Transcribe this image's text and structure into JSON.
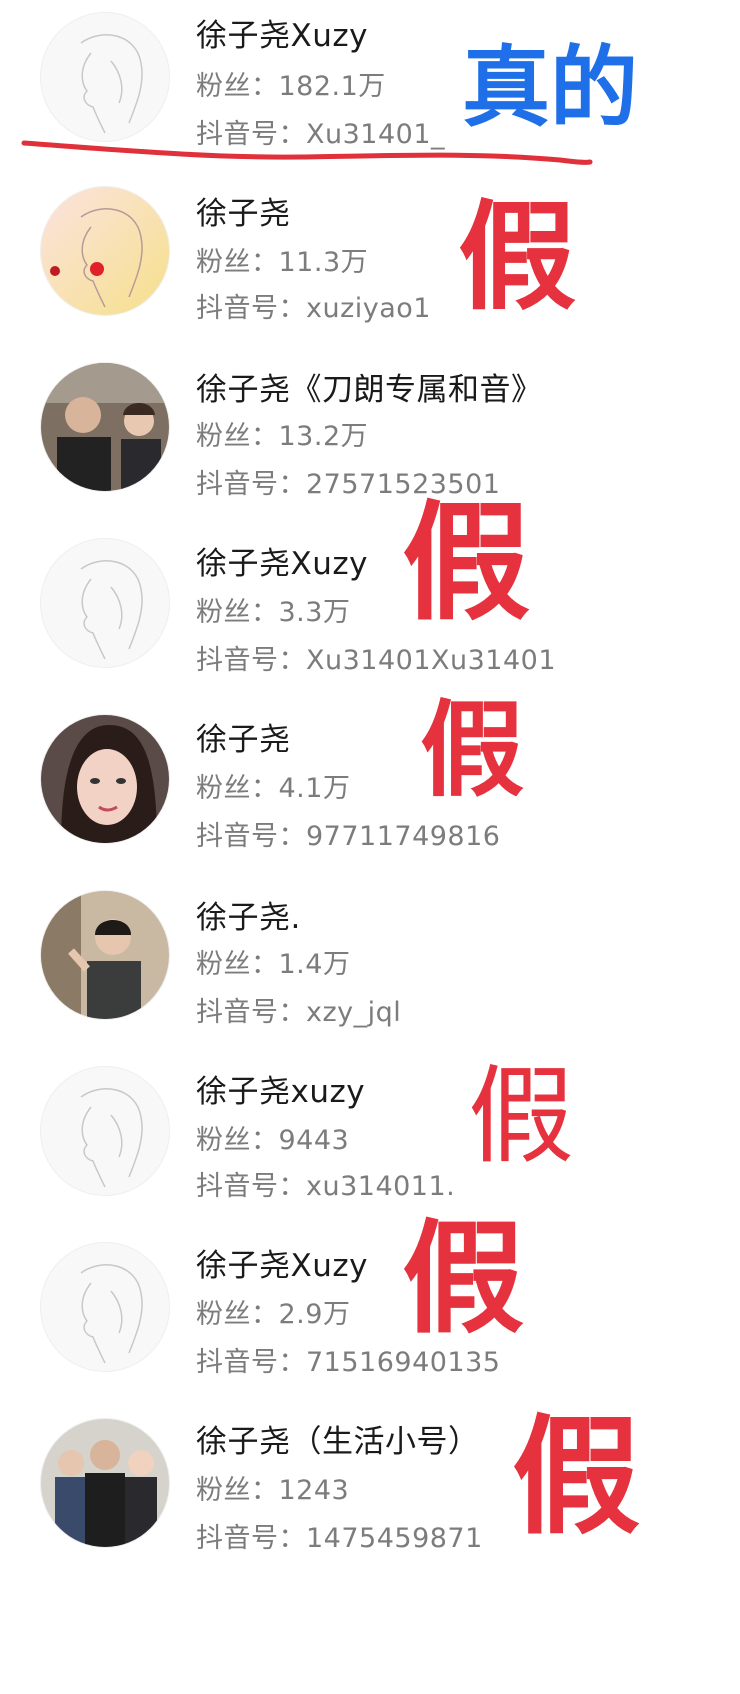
{
  "colors": {
    "fake_stamp": "#e5323e",
    "real_stamp": "#1f6fe8",
    "underline": "#e0303a",
    "name_text": "#1a1a1a",
    "meta_text": "#7c7c7c"
  },
  "accounts": [
    {
      "name": "徐子尧Xuzy",
      "fans": "粉丝：182.1万",
      "douyin_id": "抖音号：Xu31401_",
      "avatar": "line-art-portrait",
      "stamp": "真的"
    },
    {
      "name": "徐子尧",
      "fans": "粉丝：11.3万",
      "douyin_id": "抖音号：xuziyao1",
      "avatar": "line-art-portrait-red",
      "stamp": "假"
    },
    {
      "name": "徐子尧《刀朗专属和音》",
      "fans": "粉丝：13.2万",
      "douyin_id": "抖音号：27571523501",
      "avatar": "photo-two-people",
      "stamp": ""
    },
    {
      "name": "徐子尧Xuzy",
      "fans": "粉丝：3.3万",
      "douyin_id": "抖音号：Xu31401Xu31401",
      "avatar": "line-art-portrait",
      "stamp": "假"
    },
    {
      "name": "徐子尧",
      "fans": "粉丝：4.1万",
      "douyin_id": "抖音号：97711749816",
      "avatar": "photo-woman-closeup",
      "stamp": "假"
    },
    {
      "name": "徐子尧.",
      "fans": "粉丝：1.4万",
      "douyin_id": "抖音号：xzy_jql",
      "avatar": "photo-woman-waving",
      "stamp": ""
    },
    {
      "name": "徐子尧xuzy",
      "fans": "粉丝：9443",
      "douyin_id": "抖音号：xu314011.",
      "avatar": "line-art-portrait",
      "stamp": "假"
    },
    {
      "name": "徐子尧Xuzy",
      "fans": "粉丝：2.9万",
      "douyin_id": "抖音号：71516940135",
      "avatar": "line-art-portrait",
      "stamp": "假"
    },
    {
      "name": "徐子尧（生活小号）",
      "fans": "粉丝：1243",
      "douyin_id": "抖音号：1475459871",
      "avatar": "photo-group-three",
      "stamp": "假"
    }
  ]
}
